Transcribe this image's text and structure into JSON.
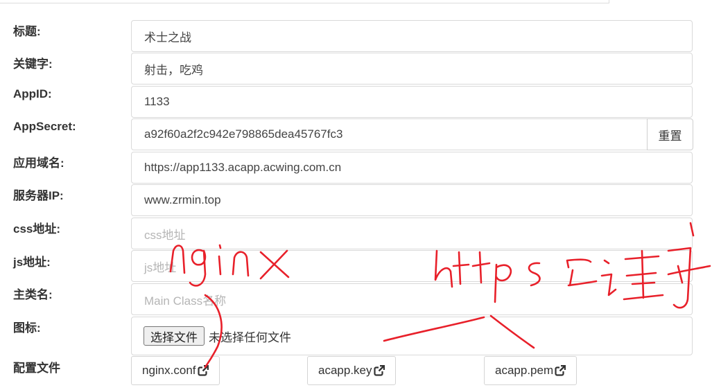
{
  "form": {
    "rows": [
      {
        "label": "标题:",
        "value": "术士之战"
      },
      {
        "label": "关键字:",
        "value": "射击，吃鸡"
      },
      {
        "label": "AppID:",
        "value": "1133"
      },
      {
        "label": "AppSecret:",
        "value": "a92f60a2f2c942e798865dea45767fc3"
      },
      {
        "label": "应用域名:",
        "value": "https://app1133.acapp.acwing.com.cn"
      },
      {
        "label": "服务器IP:",
        "value": "www.zrmin.top"
      },
      {
        "label": "css地址:",
        "placeholder": "css地址"
      },
      {
        "label": "js地址:",
        "placeholder": "js地址"
      },
      {
        "label": "主类名:",
        "placeholder": "Main Class名称"
      },
      {
        "label": "图标:"
      }
    ],
    "reset_label": "重置",
    "file_button_label": "选择文件",
    "file_status": "未选择任何文件",
    "config_label": "配置文件",
    "config_files": [
      "nginx.conf",
      "acapp.key",
      "acapp.pem"
    ]
  },
  "annotations": {
    "color": "#e8202a",
    "texts": [
      "nginx",
      "https证书"
    ]
  },
  "icons": {
    "external_link": "external-link-icon"
  }
}
